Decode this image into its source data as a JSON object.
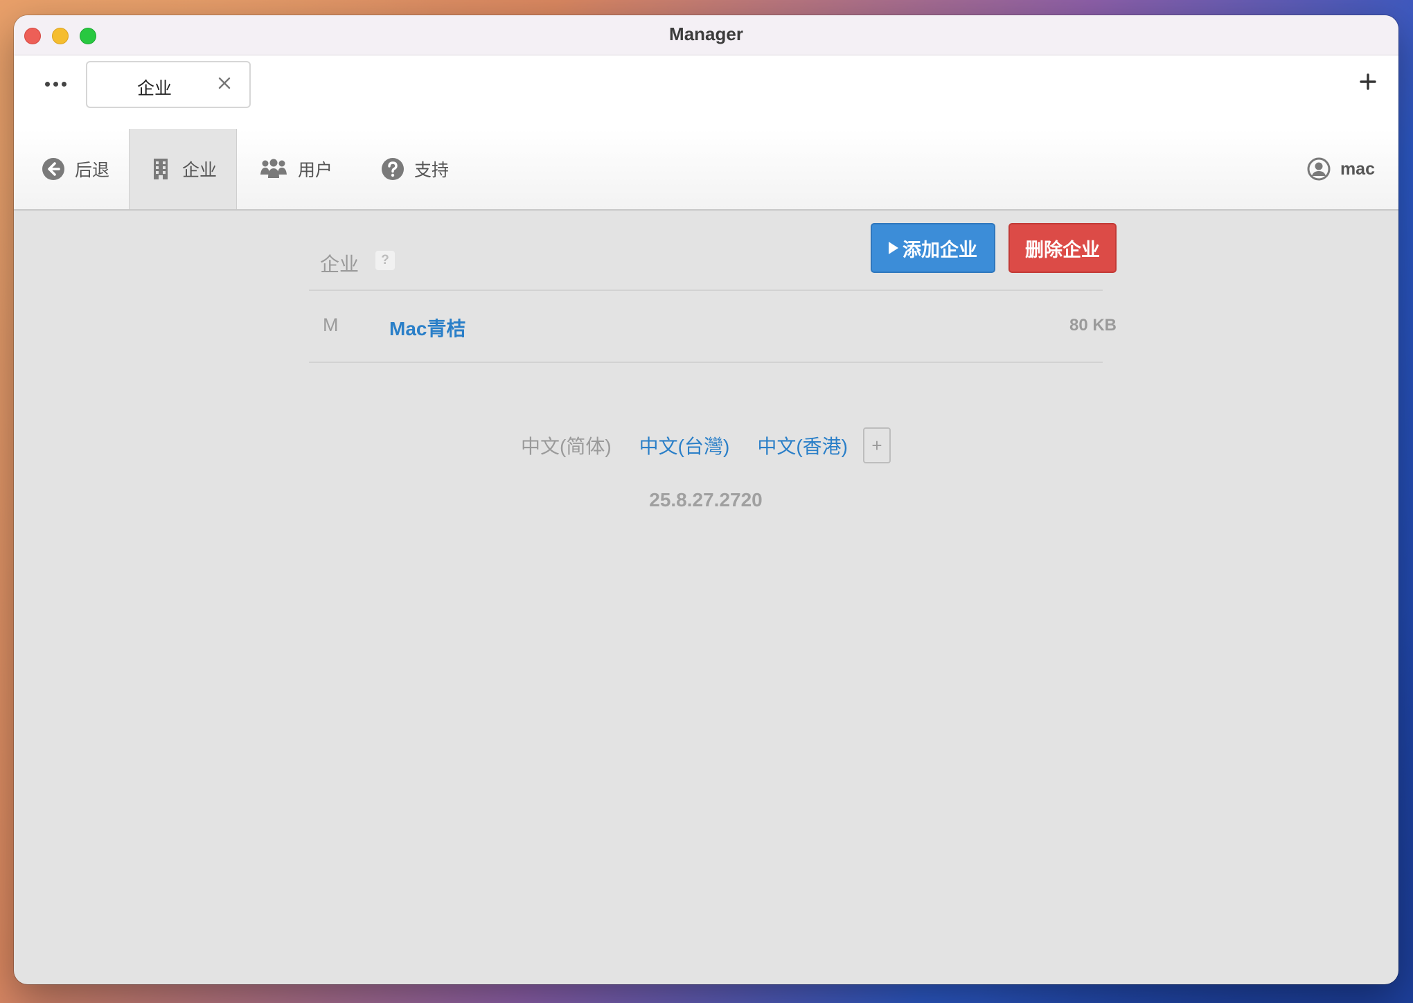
{
  "window": {
    "title": "Manager"
  },
  "tabs": {
    "active_label": "企业"
  },
  "nav": {
    "back_label": "后退",
    "company_label": "企业",
    "users_label": "用户",
    "support_label": "支持",
    "user_label": "mac"
  },
  "section": {
    "title": "企业",
    "help": "?",
    "add_label": "添加企业",
    "delete_label": "删除企业"
  },
  "companies": [
    {
      "letter": "M",
      "name": "Mac青桔",
      "size": "80 KB"
    }
  ],
  "languages": {
    "items": [
      "中文(简体)",
      "中文(台灣)",
      "中文(香港)"
    ],
    "active_index": 0,
    "add_label": "+"
  },
  "version": "25.8.27.2720",
  "icons": {
    "back": "circle-arrow-left-icon",
    "company": "building-icon",
    "users": "group-icon",
    "support": "question-circle-icon",
    "user": "user-circle-icon",
    "more": "ellipsis-icon",
    "close": "close-icon",
    "new_tab": "plus-icon",
    "add": "play-icon"
  },
  "colors": {
    "add_button": "#3c8dd8",
    "delete_button": "#dc4b47",
    "link": "#2a7fc8"
  }
}
